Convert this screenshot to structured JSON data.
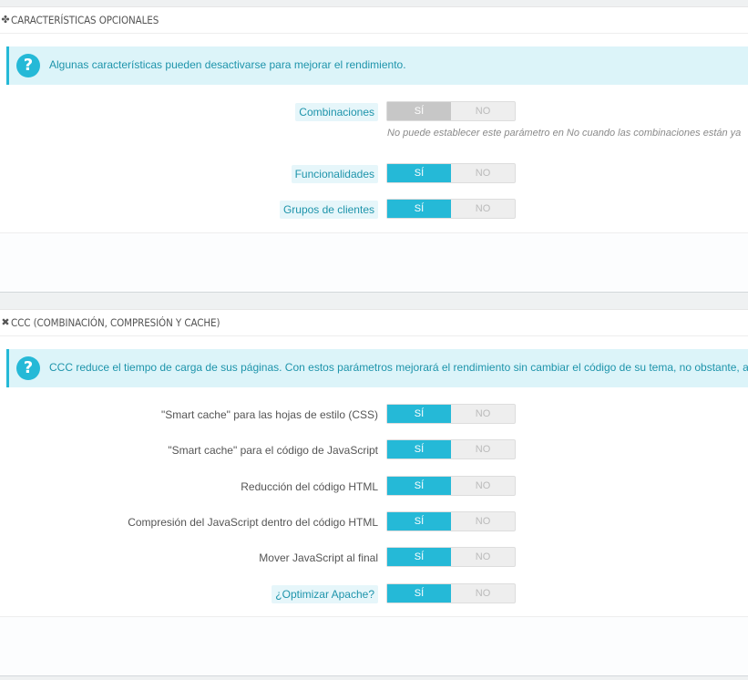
{
  "panel_optional": {
    "icon": "puzzle-icon",
    "title": "CARACTERÍSTICAS OPCIONALES",
    "alert_text": "Algunas características pueden desactivarse para mejorar el rendimiento.",
    "combinaciones": {
      "label": "Combinaciones",
      "on": "SÍ",
      "off": "NO",
      "help": "No puede establecer este parámetro en No cuando las combinaciones están ya"
    },
    "funcionalidades": {
      "label": "Funcionalidades",
      "on": "SÍ",
      "off": "NO"
    },
    "grupos": {
      "label": "Grupos de clientes",
      "on": "SÍ",
      "off": "NO"
    }
  },
  "panel_ccc": {
    "icon": "arrows-icon",
    "title": "CCC (COMBINACIÓN, COMPRESIÓN Y CACHE)",
    "alert_text": "CCC reduce el tiempo de carga de sus páginas. Con estos parámetros mejorará el rendimiento sin cambiar el código de su tema, no obstante, asegúrese",
    "css_cache": {
      "label": "\"Smart cache\" para las hojas de estilo (CSS)",
      "on": "SÍ",
      "off": "NO"
    },
    "js_cache": {
      "label": "\"Smart cache\" para el código de JavaScript",
      "on": "SÍ",
      "off": "NO"
    },
    "html_min": {
      "label": "Reducción del código HTML",
      "on": "SÍ",
      "off": "NO"
    },
    "js_compress": {
      "label": "Compresión del JavaScript dentro del código HTML",
      "on": "SÍ",
      "off": "NO"
    },
    "js_footer": {
      "label": "Mover JavaScript al final",
      "on": "SÍ",
      "off": "NO"
    },
    "apache": {
      "label": "¿Optimizar Apache?",
      "on": "SÍ",
      "off": "NO"
    }
  },
  "colors": {
    "accent": "#25b9d7",
    "alert_bg": "#dcf4f9",
    "disabled_on": "#c7c7c7"
  }
}
